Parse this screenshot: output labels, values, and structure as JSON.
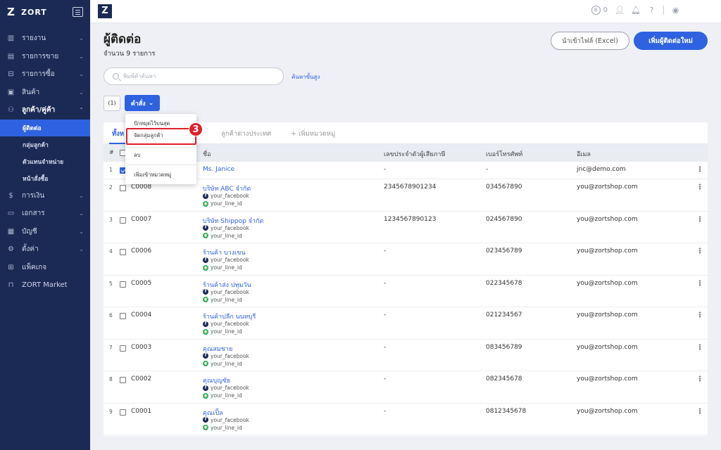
{
  "brand": {
    "name": "ZORT",
    "logo": "Z"
  },
  "sidebar": {
    "items": [
      {
        "label": "รายงาน",
        "icon": "chart-icon",
        "glyph": "▥",
        "chev": "⌄"
      },
      {
        "label": "รายการขาย",
        "icon": "clipboard-icon",
        "glyph": "▤",
        "chev": "⌄"
      },
      {
        "label": "รายการซื้อ",
        "icon": "basket-icon",
        "glyph": "⊟",
        "chev": "⌄"
      },
      {
        "label": "สินค้า",
        "icon": "box-icon",
        "glyph": "▣",
        "chev": "⌄"
      },
      {
        "label": "ลูกค้า/คู่ค้า",
        "icon": "users-icon",
        "glyph": "⚇",
        "chev": "⌃"
      }
    ],
    "subitems": [
      "ผู้ติดต่อ",
      "กลุ่มลูกค้า",
      "ตัวแทนจำหน่าย",
      "หน้าสั่งซื้อ"
    ],
    "items2": [
      {
        "label": "การเงิน",
        "icon": "money-icon",
        "glyph": "$",
        "chev": "⌄"
      },
      {
        "label": "เอกสาร",
        "icon": "document-icon",
        "glyph": "▭",
        "chev": "⌄"
      },
      {
        "label": "บัญชี",
        "icon": "ledger-icon",
        "glyph": "▦",
        "chev": "⌄"
      },
      {
        "label": "ตั้งค่า",
        "icon": "gear-icon",
        "glyph": "⚙",
        "chev": "⌄"
      },
      {
        "label": "แพ็คเกจ",
        "icon": "package-icon",
        "glyph": "⊞",
        "chev": ""
      },
      {
        "label": "ZORT Market",
        "icon": "store-icon",
        "glyph": "⊓",
        "chev": ""
      }
    ]
  },
  "topbar": {
    "coins": "0"
  },
  "header": {
    "title": "ผู้ติดต่อ",
    "count": "จำนวน 9 รายการ",
    "import_label": "นำเข้าไฟล์ (Excel)",
    "add_label": "เพิ่มผู้ติดต่อใหม่"
  },
  "search": {
    "placeholder": "พิมพ์คำค้นหา",
    "advanced": "ค้นหาขั้นสูง"
  },
  "toolbar": {
    "selected_count": "(1)",
    "command_label": "คำสั่ง"
  },
  "dropdown": {
    "items": [
      "ปักหมุดไว้บนสุด",
      "จัดกลุ่มลูกค้า",
      "ลบ",
      "เพิ่มเข้าหมวดหมู่"
    ],
    "step": "3"
  },
  "tabs": [
    "ทั้งห",
    "ลูกค้าต่างประเทศ",
    "+ เพิ่มหมวดหมู่"
  ],
  "table": {
    "headers": {
      "num": "#",
      "name": "ชื่อ",
      "tax": "เลขประจำตัวผู้เสียภาษี",
      "phone": "เบอร์โทรศัพท์",
      "email": "อีเมล"
    },
    "rows": [
      {
        "num": "1",
        "code": "",
        "name": "Ms. Janice",
        "tax": "-",
        "phone": "-",
        "email": "jnc@demo.com",
        "checked": true,
        "social": false
      },
      {
        "num": "2",
        "code": "C0008",
        "name": "บริษัท ABC จำกัด",
        "tax": "2345678901234",
        "phone": "034567890",
        "email": "you@zortshop.com",
        "checked": false,
        "social": true
      },
      {
        "num": "3",
        "code": "C0007",
        "name": "บริษัท Shippop จำกัด",
        "tax": "1234567890123",
        "phone": "024567890",
        "email": "you@zortshop.com",
        "checked": false,
        "social": true
      },
      {
        "num": "4",
        "code": "C0006",
        "name": "ร้านค้า บางเขน",
        "tax": "-",
        "phone": "023456789",
        "email": "you@zortshop.com",
        "checked": false,
        "social": true
      },
      {
        "num": "5",
        "code": "C0005",
        "name": "ร้านค้าส่ง ปทุมวัน",
        "tax": "-",
        "phone": "022345678",
        "email": "you@zortshop.com",
        "checked": false,
        "social": true
      },
      {
        "num": "6",
        "code": "C0004",
        "name": "ร้านค้าปลีก นนทบุรี",
        "tax": "-",
        "phone": "021234567",
        "email": "you@zortshop.com",
        "checked": false,
        "social": true
      },
      {
        "num": "7",
        "code": "C0003",
        "name": "คุณสมชาย",
        "tax": "-",
        "phone": "083456789",
        "email": "you@zortshop.com",
        "checked": false,
        "social": true
      },
      {
        "num": "8",
        "code": "C0002",
        "name": "คุณบุญชัย",
        "tax": "-",
        "phone": "082345678",
        "email": "you@zortshop.com",
        "checked": false,
        "social": true
      },
      {
        "num": "9",
        "code": "C0001",
        "name": "คุณเปิ้ล",
        "tax": "-",
        "phone": "0812345678",
        "email": "you@zortshop.com",
        "checked": false,
        "social": true
      }
    ],
    "facebook": "your_facebook",
    "line": "your_line_id"
  },
  "colors": {
    "accent": "#2f62e0",
    "sidebar": "#1b2a55",
    "highlight": "#e0202a"
  }
}
